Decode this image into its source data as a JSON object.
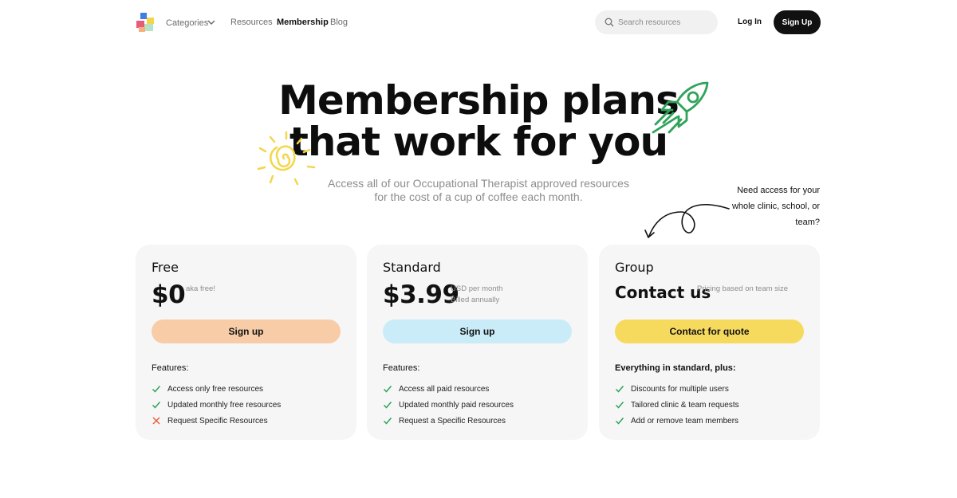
{
  "nav": {
    "categories": "Categories",
    "resources": "Resources",
    "membership": "Membership",
    "blog": "Blog",
    "search_placeholder": "Search resources",
    "login": "Log In",
    "signup": "Sign Up"
  },
  "hero": {
    "title_line1": "Membership plans",
    "title_line2": "that work for you",
    "subtitle": "Access all of our Occupational Therapist approved resources for the cost of a cup of coffee each month.",
    "side_note": "Need access for your whole clinic, school, or team?"
  },
  "plans": [
    {
      "name": "Free",
      "price": "$0",
      "price_note": "aka free!",
      "cta": "Sign up",
      "features_heading": "Features:",
      "features": [
        {
          "text": "Access only free resources",
          "included": true
        },
        {
          "text": "Updated monthly free resources",
          "included": true
        },
        {
          "text": "Request Specific Resources",
          "included": false
        }
      ]
    },
    {
      "name": "Standard",
      "price": "$3.99",
      "price_note_line1": "USD per month",
      "price_note_line2": "Billed annually",
      "cta": "Sign up",
      "features_heading": "Features:",
      "features": [
        {
          "text": "Access all paid resources",
          "included": true
        },
        {
          "text": "Updated monthly paid resources",
          "included": true
        },
        {
          "text": "Request a Specific Resources",
          "included": true
        }
      ]
    },
    {
      "name": "Group",
      "price": "Contact us",
      "price_note": "Pricing based on team size",
      "cta": "Contact for quote",
      "features_heading": "Everything in standard, plus:",
      "features": [
        {
          "text": "Discounts for multiple users",
          "included": true
        },
        {
          "text": "Tailored clinic & team requests",
          "included": true
        },
        {
          "text": "Add or remove team members",
          "included": true
        }
      ]
    }
  ],
  "colors": {
    "free_cta": "#f8cca6",
    "standard_cta": "#c9ecf8",
    "group_cta": "#f6da5e",
    "check": "#2fa35a",
    "cross": "#e8643c",
    "rocket": "#2fa35a",
    "sun": "#f4d64a",
    "card_bg": "#f6f6f6"
  },
  "icons": [
    "logo-icon",
    "chevron-down-icon",
    "search-icon",
    "sun-doodle-icon",
    "rocket-doodle-icon",
    "curly-arrow-icon",
    "check-icon",
    "cross-icon"
  ]
}
